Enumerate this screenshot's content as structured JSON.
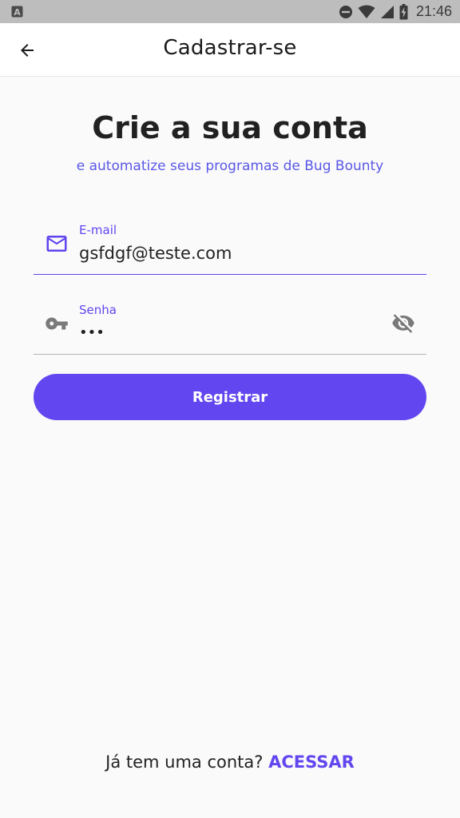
{
  "status_bar": {
    "time": "21:46",
    "left_icon": "a-icon",
    "icons": [
      "dnd-icon",
      "wifi-icon",
      "signal-icon",
      "battery-charging-icon"
    ]
  },
  "app_bar": {
    "title": "Cadastrar-se",
    "back_icon": "arrow-back-icon"
  },
  "main": {
    "heading": "Crie a sua conta",
    "subheading": "e automatize seus programas de Bug Bounty"
  },
  "form": {
    "email": {
      "label": "E-mail",
      "value": "gsfdgf@teste.com",
      "icon": "mail-icon"
    },
    "password": {
      "label": "Senha",
      "value": "•••",
      "icon": "key-icon",
      "toggle_icon": "visibility-off-icon"
    },
    "submit_label": "Registrar"
  },
  "footer": {
    "prompt": "Já tem uma conta? ",
    "link": "ACESSAR"
  },
  "colors": {
    "accent": "#6246ef",
    "subtitle": "#5a57e6",
    "status_bar": "#bdbdbd"
  }
}
